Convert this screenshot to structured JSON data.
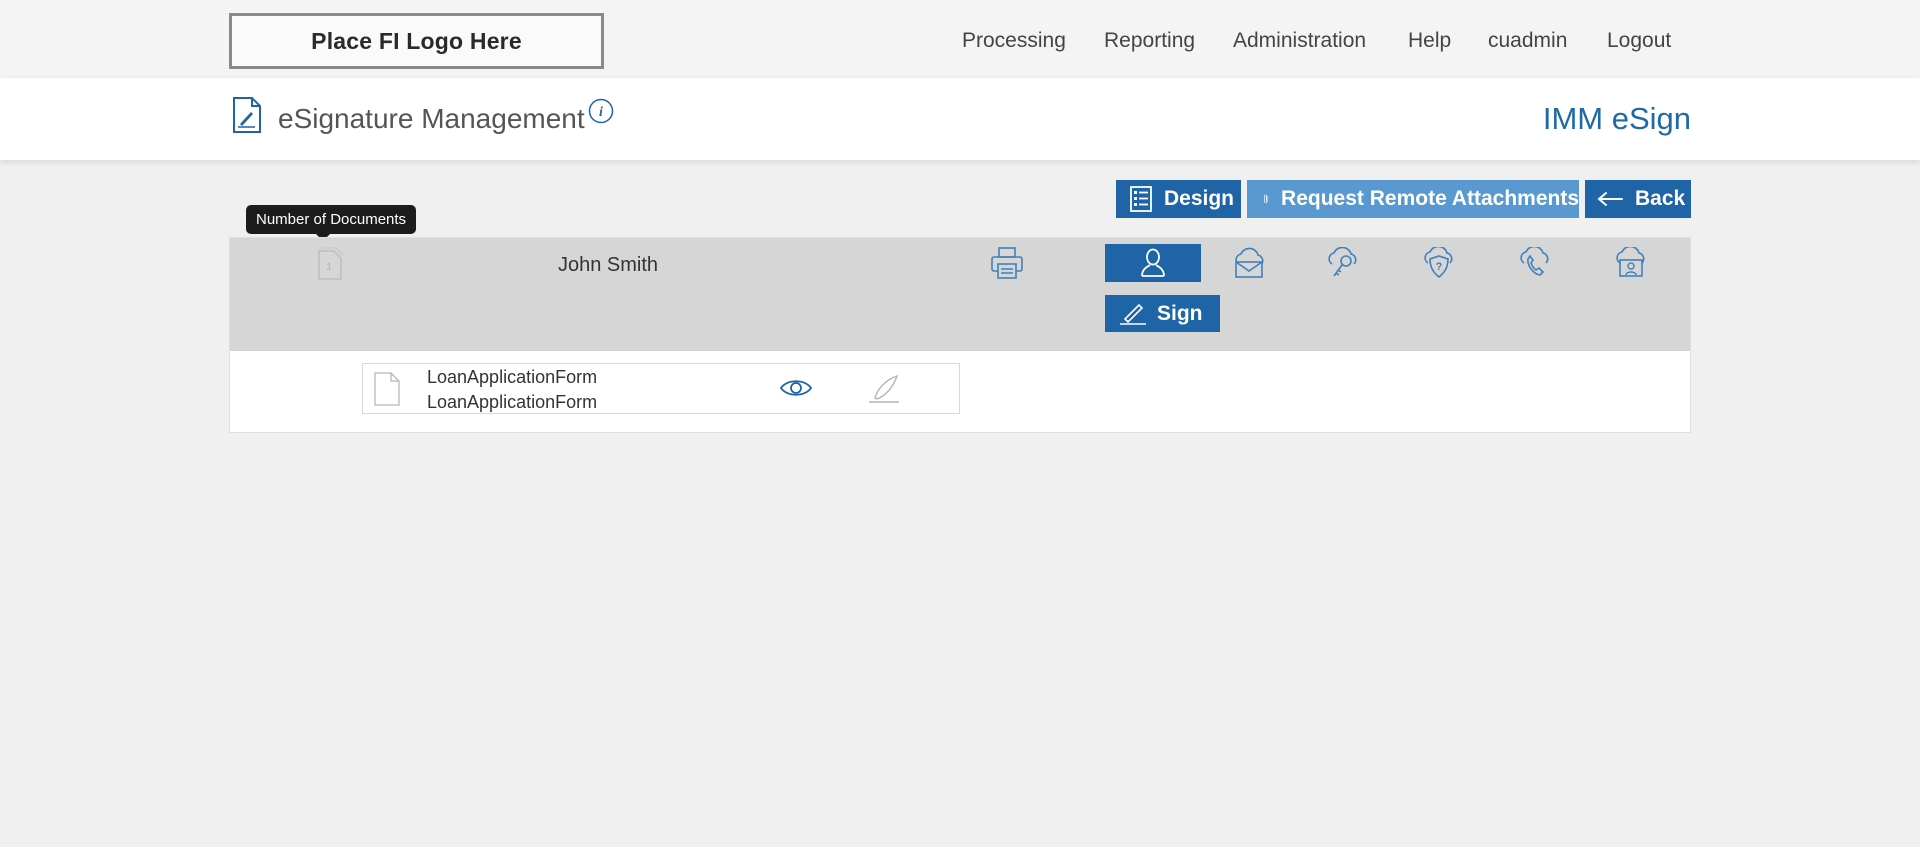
{
  "topbar": {
    "logo_text": "Place FI Logo Here",
    "nav": [
      "Processing",
      "Reporting",
      "Administration",
      "Help",
      "cuadmin",
      "Logout"
    ]
  },
  "header": {
    "title": "eSignature Management",
    "brand": "IMM eSign"
  },
  "actions": {
    "design": "Design",
    "remote": "Request Remote Attachments",
    "back": "Back"
  },
  "tooltip": "Number of Documents",
  "signer": {
    "doc_count": "1",
    "name": "John Smith",
    "auth_methods": [
      "person-icon",
      "email-cloud-icon",
      "key-cloud-icon",
      "question-shield-icon",
      "phone-cloud-icon",
      "id-cloud-icon"
    ],
    "active_auth": "person-icon",
    "sign_label": "Sign"
  },
  "document": {
    "name_line1": "LoanApplicationForm",
    "name_line2": "LoanApplicationForm"
  },
  "colors": {
    "accent": "#1f64a6",
    "accent_light": "#5a99cf",
    "brand": "#1f6aa5"
  }
}
